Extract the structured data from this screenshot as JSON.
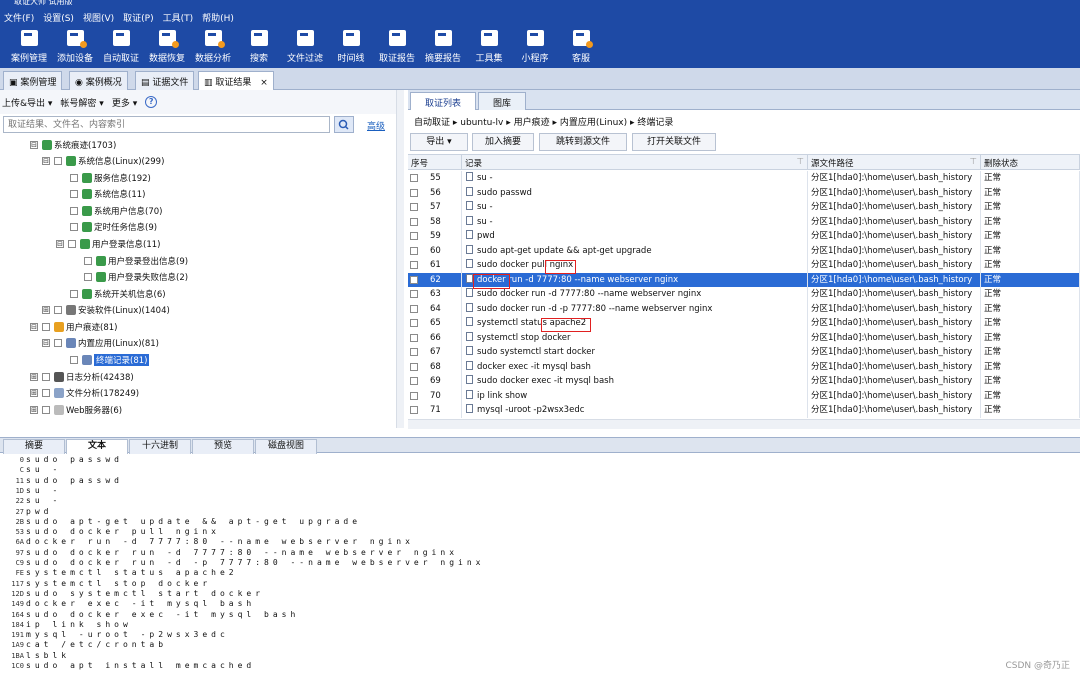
{
  "app": {
    "title": "取证大师 试用版"
  },
  "menu": [
    "文件(F)",
    "设置(S)",
    "视图(V)",
    "取证(P)",
    "工具(T)",
    "帮助(H)"
  ],
  "toolbar": [
    "案例管理",
    "添加设备",
    "自动取证",
    "数据恢复",
    "数据分析",
    "搜索",
    "文件过滤",
    "时间线",
    "取证报告",
    "摘要报告",
    "工具集",
    "小程序",
    "客服"
  ],
  "main_tabs": [
    "案例管理",
    "案例概况",
    "证据文件",
    "取证结果"
  ],
  "left": {
    "tools": [
      "上传&导出",
      "帐号解密",
      "更多"
    ],
    "help": "?",
    "search_placeholder": "取证结果、文件名、内容索引",
    "advanced": "高级",
    "tree": [
      {
        "label": "系统痕迹(1703)",
        "toggle": "⊟"
      },
      {
        "label": "系统信息(Linux)(299)",
        "toggle": "⊟"
      },
      {
        "label": "服务信息(192)",
        "toggle": ""
      },
      {
        "label": "系统信息(11)",
        "toggle": ""
      },
      {
        "label": "系统用户信息(70)",
        "toggle": ""
      },
      {
        "label": "定时任务信息(9)",
        "toggle": ""
      },
      {
        "label": "用户登录信息(11)",
        "toggle": "⊟"
      },
      {
        "label": "用户登录登出信息(9)",
        "toggle": ""
      },
      {
        "label": "用户登录失败信息(2)",
        "toggle": ""
      },
      {
        "label": "系统开关机信息(6)",
        "toggle": ""
      },
      {
        "label": "安装软件(Linux)(1404)",
        "toggle": "⊞"
      },
      {
        "label": "用户痕迹(81)",
        "toggle": "⊟"
      },
      {
        "label": "内置应用(Linux)(81)",
        "toggle": "⊟"
      },
      {
        "label": "终端记录(81)",
        "toggle": ""
      },
      {
        "label": "日志分析(42438)",
        "toggle": "⊞"
      },
      {
        "label": "文件分析(178249)",
        "toggle": "⊞"
      },
      {
        "label": "Web服务器(6)",
        "toggle": "⊞"
      }
    ]
  },
  "right": {
    "tabs": [
      "取证列表",
      "图库"
    ],
    "breadcrumb": "自动取证  ▸  ubuntu-lv  ▸  用户痕迹  ▸  内置应用(Linux)  ▸  终端记录",
    "buttons": [
      "导出",
      "加入摘要",
      "跳转到源文件",
      "打开关联文件"
    ],
    "columns": [
      "序号",
      "记录",
      "源文件路径",
      "删除状态"
    ],
    "rows": [
      {
        "n": "55",
        "rec": "su -",
        "path": "分区1[hda0]:\\home\\user\\.bash_history",
        "st": "正常"
      },
      {
        "n": "56",
        "rec": "sudo passwd",
        "path": "分区1[hda0]:\\home\\user\\.bash_history",
        "st": "正常"
      },
      {
        "n": "57",
        "rec": "su -",
        "path": "分区1[hda0]:\\home\\user\\.bash_history",
        "st": "正常"
      },
      {
        "n": "58",
        "rec": "su -",
        "path": "分区1[hda0]:\\home\\user\\.bash_history",
        "st": "正常"
      },
      {
        "n": "59",
        "rec": "pwd",
        "path": "分区1[hda0]:\\home\\user\\.bash_history",
        "st": "正常"
      },
      {
        "n": "60",
        "rec": "sudo apt-get update && apt-get upgrade",
        "path": "分区1[hda0]:\\home\\user\\.bash_history",
        "st": "正常"
      },
      {
        "n": "61",
        "rec": "sudo docker pull nginx",
        "path": "分区1[hda0]:\\home\\user\\.bash_history",
        "st": "正常"
      },
      {
        "n": "62",
        "rec": "docker run -d 7777:80 --name webserver nginx",
        "path": "分区1[hda0]:\\home\\user\\.bash_history",
        "st": "正常"
      },
      {
        "n": "63",
        "rec": "sudo docker run -d 7777:80 --name webserver nginx",
        "path": "分区1[hda0]:\\home\\user\\.bash_history",
        "st": "正常"
      },
      {
        "n": "64",
        "rec": "sudo docker run -d -p 7777:80 --name webserver nginx",
        "path": "分区1[hda0]:\\home\\user\\.bash_history",
        "st": "正常"
      },
      {
        "n": "65",
        "rec": "systemctl status apache2",
        "path": "分区1[hda0]:\\home\\user\\.bash_history",
        "st": "正常"
      },
      {
        "n": "66",
        "rec": "systemctl stop docker",
        "path": "分区1[hda0]:\\home\\user\\.bash_history",
        "st": "正常"
      },
      {
        "n": "67",
        "rec": "sudo systemctl start docker",
        "path": "分区1[hda0]:\\home\\user\\.bash_history",
        "st": "正常"
      },
      {
        "n": "68",
        "rec": "docker exec -it mysql bash",
        "path": "分区1[hda0]:\\home\\user\\.bash_history",
        "st": "正常"
      },
      {
        "n": "69",
        "rec": "sudo docker exec -it mysql bash",
        "path": "分区1[hda0]:\\home\\user\\.bash_history",
        "st": "正常"
      },
      {
        "n": "70",
        "rec": "ip link show",
        "path": "分区1[hda0]:\\home\\user\\.bash_history",
        "st": "正常"
      },
      {
        "n": "71",
        "rec": "mysql -uroot -p2wsx3edc",
        "path": "分区1[hda0]:\\home\\user\\.bash_history",
        "st": "正常"
      }
    ]
  },
  "bottom": {
    "tabs": [
      "摘要",
      "文本",
      "十六进制",
      "预览",
      "磁盘视图"
    ],
    "lines": [
      {
        "off": "0",
        "text": "sudo passwd"
      },
      {
        "off": "C",
        "text": "su -"
      },
      {
        "off": "11",
        "text": "sudo passwd"
      },
      {
        "off": "1D",
        "text": "su -"
      },
      {
        "off": "22",
        "text": "su -"
      },
      {
        "off": "27",
        "text": "pwd"
      },
      {
        "off": "2B",
        "text": "sudo apt-get update && apt-get upgrade"
      },
      {
        "off": "53",
        "text": "sudo docker pull nginx"
      },
      {
        "off": "6A",
        "text": "docker run -d 7777:80 --name webserver nginx"
      },
      {
        "off": "97",
        "text": "sudo docker run -d 7777:80 --name webserver nginx"
      },
      {
        "off": "C9",
        "text": "sudo docker run -d -p 7777:80 --name webserver nginx"
      },
      {
        "off": "FE",
        "text": "systemctl status apache2"
      },
      {
        "off": "117",
        "text": "systemctl stop docker"
      },
      {
        "off": "12D",
        "text": "sudo systemctl start docker"
      },
      {
        "off": "149",
        "text": "docker exec -it mysql bash"
      },
      {
        "off": "164",
        "text": "sudo docker exec -it mysql bash"
      },
      {
        "off": "184",
        "text": "ip link show"
      },
      {
        "off": "191",
        "text": "mysql -uroot -p2wsx3edc"
      },
      {
        "off": "1A9",
        "text": "cat /etc/crontab"
      },
      {
        "off": "1BA",
        "text": "lsblk"
      },
      {
        "off": "1C0",
        "text": "sudo apt install memcached"
      }
    ]
  },
  "watermark": "CSDN @奇乃正"
}
